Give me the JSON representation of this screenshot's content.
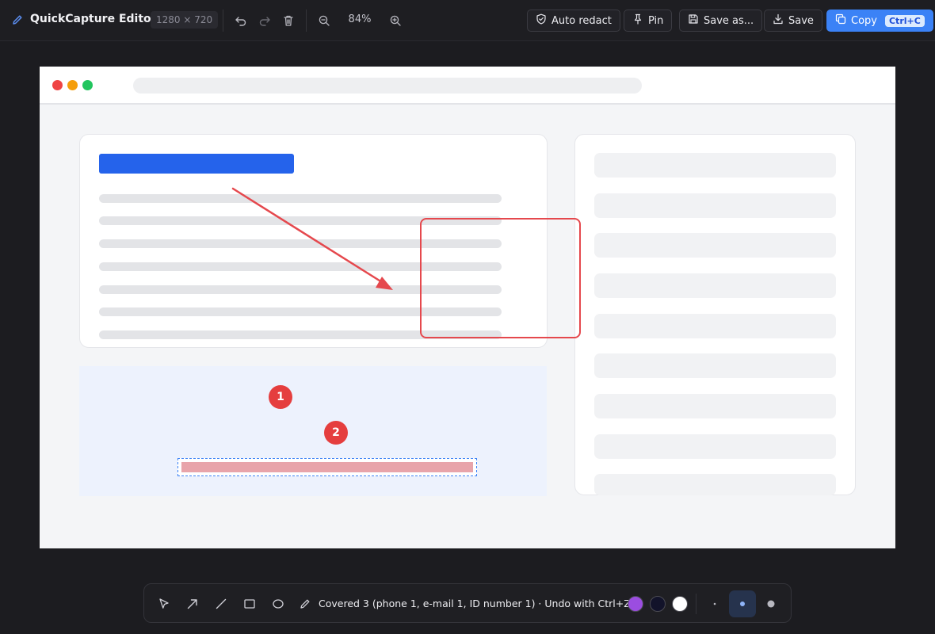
{
  "header": {
    "app_title": "QuickCapture Editor",
    "image_dims": "1280 × 720",
    "zoom_level": "84%",
    "icons": [
      "pencil-icon",
      "undo-icon",
      "redo-icon",
      "trash-icon",
      "zoom-out-icon",
      "zoom-in-icon"
    ],
    "buttons": {
      "auto_redact": "Auto redact",
      "pin": "Pin",
      "save_as": "Save as...",
      "save": "Save",
      "copy": "Copy",
      "copy_shortcut": "Ctrl+C"
    }
  },
  "canvas": {
    "annotations": {
      "pins": [
        "1",
        "2"
      ],
      "colors": {
        "annotation_red": "#e5484d",
        "selection_blue": "#3b82f6",
        "redaction_fill": "#e8a4aa"
      }
    }
  },
  "palette": {
    "tools": [
      "select-tool",
      "arrow-tool",
      "line-tool",
      "rectangle-tool",
      "ellipse-tool",
      "pen-tool"
    ],
    "status": "Covered 3 (phone 1, e-mail 1, ID number 1) · Undo with Ctrl+Z",
    "colors": [
      "#9b4de0",
      "#12132a",
      "#ffffff"
    ],
    "stroke_sizes": [
      "small",
      "medium",
      "large"
    ],
    "active_stroke_size": "medium"
  }
}
